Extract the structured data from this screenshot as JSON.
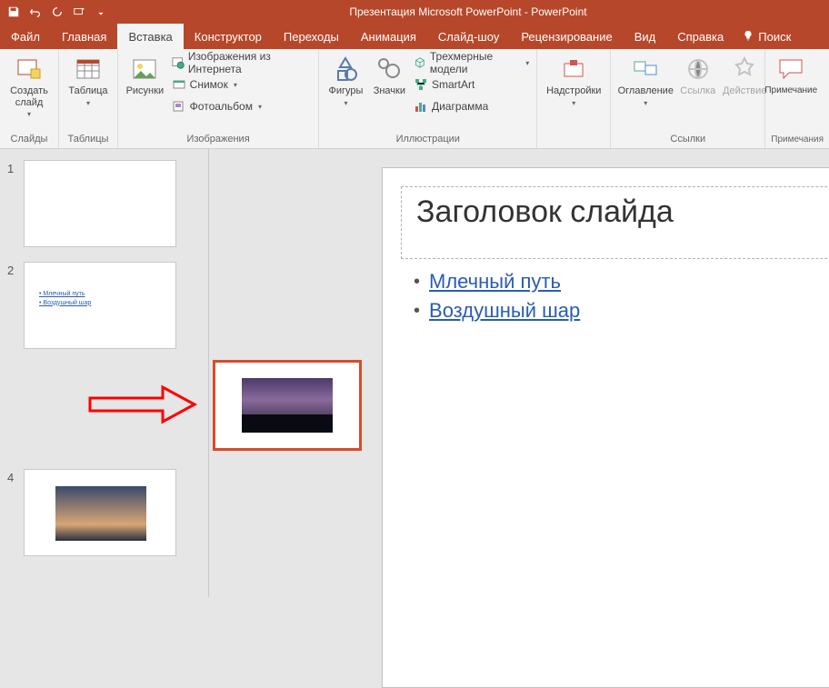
{
  "title": "Презентация Microsoft PowerPoint - PowerPoint",
  "menus": {
    "file": "Файл",
    "home": "Главная",
    "insert": "Вставка",
    "design": "Конструктор",
    "transitions": "Переходы",
    "animations": "Анимация",
    "slideshow": "Слайд-шоу",
    "review": "Рецензирование",
    "view": "Вид",
    "help": "Справка",
    "search": "Поиск"
  },
  "ribbon": {
    "slides": {
      "new_slide": "Создать слайд",
      "group": "Слайды"
    },
    "tables": {
      "table": "Таблица",
      "group": "Таблицы"
    },
    "images": {
      "pictures": "Рисунки",
      "online_pictures": "Изображения из Интернета",
      "screenshot": "Снимок",
      "photo_album": "Фотоальбом",
      "group": "Изображения"
    },
    "illustrations": {
      "shapes": "Фигуры",
      "icons": "Значки",
      "models3d": "Трехмерные модели",
      "smartart": "SmartArt",
      "chart": "Диаграмма",
      "group": "Иллюстрации"
    },
    "addins": {
      "addins": "Надстройки"
    },
    "links": {
      "toc": "Оглавление",
      "link": "Ссылка",
      "action": "Действие",
      "group": "Ссылки"
    },
    "comments": {
      "comment": "Примечание",
      "group": "Примечания"
    }
  },
  "thumbnails": {
    "n1": "1",
    "n2": "2",
    "n4": "4",
    "t2_link1": "Млечный путь",
    "t2_link2": "Воздушный шар"
  },
  "slide": {
    "title": "Заголовок слайда",
    "link1": "Млечный путь",
    "link2": "Воздушный шар"
  }
}
